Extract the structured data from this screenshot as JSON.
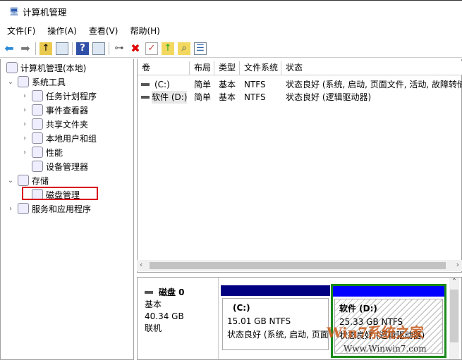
{
  "window": {
    "title": "计算机管理"
  },
  "menu": [
    "文件(F)",
    "操作(A)",
    "查看(V)",
    "帮助(H)"
  ],
  "tree": [
    {
      "label": "计算机管理(本地)",
      "icon": "computer-management-icon",
      "expander": ""
    },
    {
      "label": "系统工具",
      "icon": "tools-icon",
      "expander": "⌄"
    },
    {
      "label": "任务计划程序",
      "icon": "clock-icon",
      "expander": "›"
    },
    {
      "label": "事件查看器",
      "icon": "event-viewer-icon",
      "expander": "›"
    },
    {
      "label": "共享文件夹",
      "icon": "shared-folder-icon",
      "expander": "›"
    },
    {
      "label": "本地用户和组",
      "icon": "users-icon",
      "expander": "›"
    },
    {
      "label": "性能",
      "icon": "performance-icon",
      "expander": "›"
    },
    {
      "label": "设备管理器",
      "icon": "device-manager-icon",
      "expander": ""
    },
    {
      "label": "存储",
      "icon": "storage-icon",
      "expander": "⌄"
    },
    {
      "label": "磁盘管理",
      "icon": "disk-icon",
      "expander": ""
    },
    {
      "label": "服务和应用程序",
      "icon": "services-icon",
      "expander": "›"
    }
  ],
  "columns": [
    "卷",
    "布局",
    "类型",
    "文件系统",
    "状态"
  ],
  "volumes": [
    {
      "name": "(C:)",
      "layout": "简单",
      "type": "基本",
      "fs": "NTFS",
      "status": "状态良好 (系统, 启动, 页面文件, 活动, 故障转储"
    },
    {
      "name": "软件 (D:)",
      "layout": "简单",
      "type": "基本",
      "fs": "NTFS",
      "status": "状态良好 (逻辑驱动器)"
    }
  ],
  "disk": {
    "name": "磁盘 0",
    "type": "基本",
    "size": "40.34 GB",
    "state": "联机",
    "partitions": [
      {
        "label": "(C:)",
        "size": "15.01 GB NTFS",
        "status": "状态良好 (系统, 启动, 页面文件, 活动, 故障转储, 主分区)",
        "color": "#000080"
      },
      {
        "label": "软件 (D:)",
        "size": "25.33 GB NTFS",
        "status": "状态良好 (逻辑驱动器)",
        "color": "#0000ff"
      }
    ]
  },
  "watermark": {
    "text": "Win7系统之家",
    "url": "Www.Winwin7.com"
  },
  "colors": {
    "selection_outline": "#d9001b",
    "selected_partition": "#1a8a1a"
  }
}
